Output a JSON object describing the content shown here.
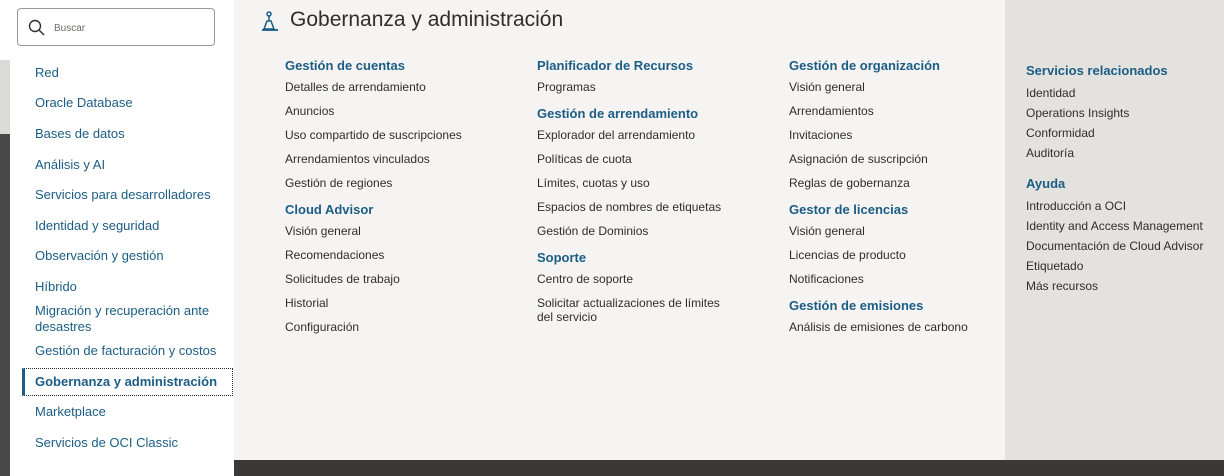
{
  "search": {
    "placeholder": "Buscar"
  },
  "sidebar": {
    "items": [
      {
        "label": "Red"
      },
      {
        "label": "Oracle Database"
      },
      {
        "label": "Bases de datos"
      },
      {
        "label": "Análisis y AI"
      },
      {
        "label": "Servicios para desarrolladores"
      },
      {
        "label": "Identidad y seguridad"
      },
      {
        "label": "Observación y gestión"
      },
      {
        "label": "Híbrido"
      },
      {
        "label": "Migración y recuperación ante desastres"
      },
      {
        "label": "Gestión de facturación y costos"
      },
      {
        "label": "Gobernanza y administración"
      },
      {
        "label": "Marketplace"
      },
      {
        "label": "Servicios de OCI Classic"
      }
    ]
  },
  "main": {
    "title": "Gobernanza y administración",
    "col1": {
      "s1": {
        "title": "Gestión de cuentas",
        "links": [
          "Detalles de arrendamiento",
          "Anuncios",
          "Uso compartido de suscripciones",
          "Arrendamientos vinculados",
          "Gestión de regiones"
        ]
      },
      "s2": {
        "title": "Cloud Advisor",
        "links": [
          "Visión general",
          "Recomendaciones",
          "Solicitudes de trabajo",
          "Historial",
          "Configuración"
        ]
      }
    },
    "col2": {
      "s1": {
        "title": "Planificador de Recursos",
        "links": [
          "Programas"
        ]
      },
      "s2": {
        "title": "Gestión de arrendamiento",
        "links": [
          "Explorador del arrendamiento",
          "Políticas de cuota",
          "Límites, cuotas y uso",
          "Espacios de nombres de etiquetas",
          "Gestión de Dominios"
        ]
      },
      "s3": {
        "title": "Soporte",
        "links": [
          "Centro de soporte",
          "Solicitar actualizaciones de límites del servicio"
        ]
      }
    },
    "col3": {
      "s1": {
        "title": "Gestión de organización",
        "links": [
          "Visión general",
          "Arrendamientos",
          "Invitaciones",
          "Asignación de suscripción",
          "Reglas de gobernanza"
        ]
      },
      "s2": {
        "title": "Gestor de licencias",
        "links": [
          "Visión general",
          "Licencias de producto",
          "Notificaciones"
        ]
      },
      "s3": {
        "title": "Gestión de emisiones",
        "links": [
          "Análisis de emisiones de carbono"
        ]
      }
    }
  },
  "related": {
    "s1": {
      "title": "Servicios relacionados",
      "links": [
        "Identidad",
        "Operations Insights",
        "Conformidad",
        "Auditoría"
      ]
    },
    "s2": {
      "title": "Ayuda",
      "links": [
        "Introducción a OCI",
        "Identity and Access Management",
        "Documentación de Cloud Advisor",
        "Etiquetado",
        "Más recursos"
      ]
    }
  }
}
